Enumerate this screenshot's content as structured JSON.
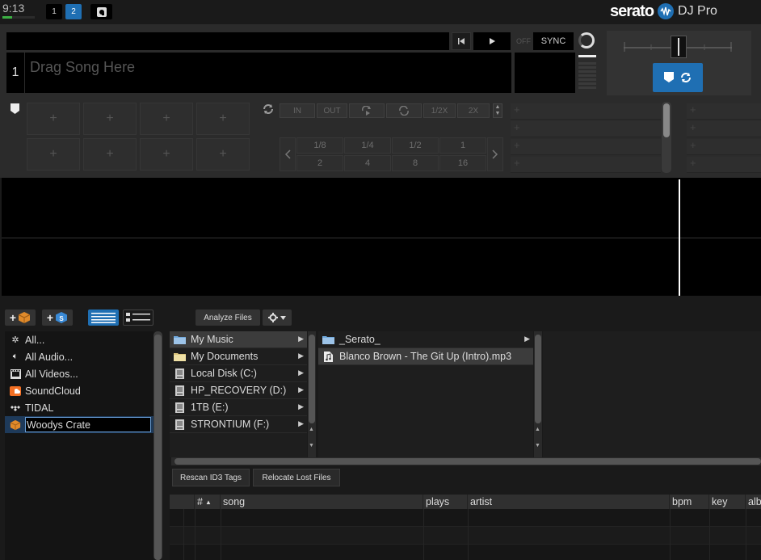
{
  "topbar": {
    "clock": "9:13",
    "clock_level": 0.3,
    "deck_buttons": [
      "1",
      "2"
    ],
    "logo_brand": "serato",
    "logo_product": "DJ Pro"
  },
  "deck": {
    "number": "1",
    "drop_placeholder": "Drag Song Here",
    "off_label": "OFF",
    "sync_label": "SYNC"
  },
  "loop": {
    "in_label": "IN",
    "out_label": "OUT",
    "half_label": "1/2X",
    "double_label": "2X",
    "beats_top": [
      "1/8",
      "1/4",
      "1/2",
      "1"
    ],
    "beats_bottom": [
      "2",
      "4",
      "8",
      "16"
    ]
  },
  "pads": {
    "plus": "+"
  },
  "library": {
    "analyze_label": "Analyze Files",
    "crates": [
      {
        "label": "All...",
        "icon": "gear-star-icon"
      },
      {
        "label": "All Audio...",
        "icon": "speaker-icon"
      },
      {
        "label": "All Videos...",
        "icon": "film-icon"
      },
      {
        "label": "SoundCloud",
        "icon": "soundcloud-icon"
      },
      {
        "label": "TIDAL",
        "icon": "tidal-icon"
      }
    ],
    "active_crate_value": "Woodys Crate",
    "locations": [
      {
        "label": "My Music",
        "icon": "folder-icon"
      },
      {
        "label": "My Documents",
        "icon": "folder-icon"
      },
      {
        "label": "Local Disk (C:)",
        "icon": "drive-icon"
      },
      {
        "label": "HP_RECOVERY (D:)",
        "icon": "drive-icon"
      },
      {
        "label": "1TB (E:)",
        "icon": "drive-icon"
      },
      {
        "label": "STRONTIUM (F:)",
        "icon": "drive-icon"
      }
    ],
    "files": [
      {
        "label": "_Serato_",
        "icon": "folder-icon",
        "has_arrow": true
      },
      {
        "label": "Blanco Brown - The Git Up (Intro).mp3",
        "icon": "audio-file-icon",
        "has_arrow": false
      }
    ],
    "rescan_label": "Rescan ID3 Tags",
    "relocate_label": "Relocate Lost Files",
    "columns": {
      "num": "#",
      "song": "song",
      "plays": "plays",
      "artist": "artist",
      "bpm": "bpm",
      "key": "key",
      "album": "alb"
    }
  },
  "colors": {
    "accent": "#1f6fb3",
    "background": "#1a1a1a",
    "panel": "#2b2b2b"
  }
}
